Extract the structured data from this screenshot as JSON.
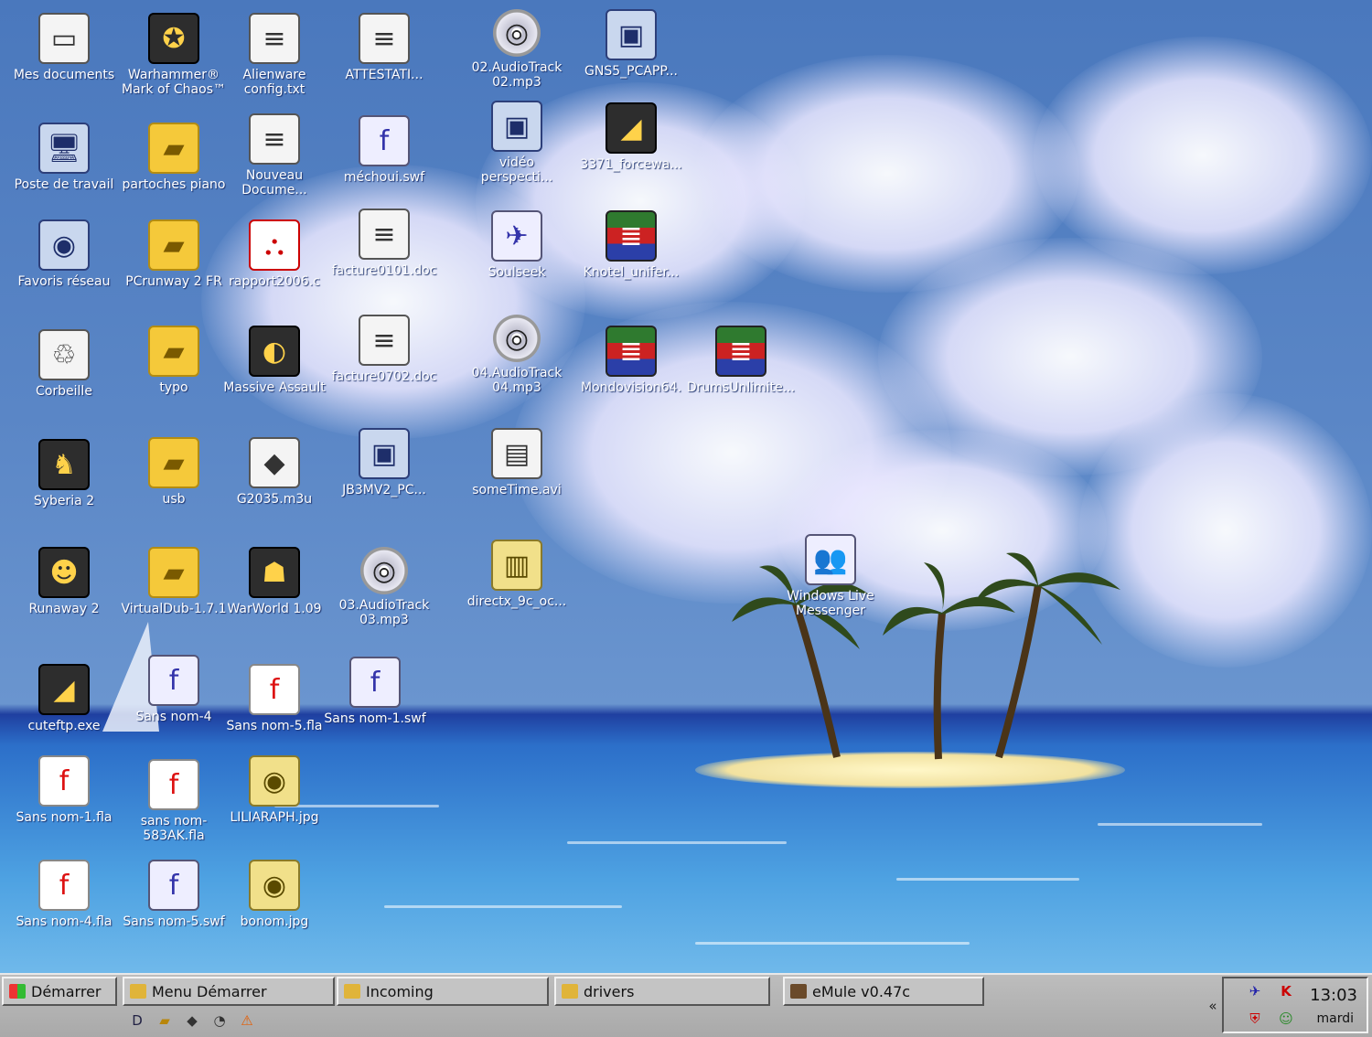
{
  "desktop": {
    "icons": [
      {
        "label": "Mes documents",
        "glyph": "▭",
        "kind": "doc"
      },
      {
        "label": "Warhammer® Mark of Chaos™",
        "glyph": "✪",
        "kind": "app"
      },
      {
        "label": "Alienware config.txt",
        "glyph": "≡",
        "kind": "doc"
      },
      {
        "label": "ATTESTATI...",
        "glyph": "≡",
        "kind": "doc"
      },
      {
        "label": "02.AudioTrack 02.mp3",
        "glyph": "◎",
        "kind": "disc"
      },
      {
        "label": "GNS5_PCAPP...",
        "glyph": "▣",
        "kind": "pc"
      },
      {
        "label": "Poste de travail",
        "glyph": "🖥",
        "kind": "pc"
      },
      {
        "label": "partoches piano",
        "glyph": "▰",
        "kind": "folder"
      },
      {
        "label": "Nouveau Docume...",
        "glyph": "≡",
        "kind": "doc"
      },
      {
        "label": "méchoui.swf",
        "glyph": "f",
        "kind": "swf"
      },
      {
        "label": "vidéo perspecti...",
        "glyph": "▣",
        "kind": "pc"
      },
      {
        "label": "3371_forcewa...",
        "glyph": "◢",
        "kind": "app"
      },
      {
        "label": "Favoris réseau",
        "glyph": "◉",
        "kind": "pc"
      },
      {
        "label": "PCrunway 2 FR",
        "glyph": "▰",
        "kind": "folder"
      },
      {
        "label": "rapport2006.c",
        "glyph": "⛬",
        "kind": "pdf"
      },
      {
        "label": "facture0101.doc",
        "glyph": "≡",
        "kind": "doc"
      },
      {
        "label": "Soulseek",
        "glyph": "✈",
        "kind": "swf"
      },
      {
        "label": "Knotel_unifer...",
        "glyph": "≣",
        "kind": "rar"
      },
      {
        "label": "Corbeille",
        "glyph": "♲",
        "kind": "doc"
      },
      {
        "label": "typo",
        "glyph": "▰",
        "kind": "folder"
      },
      {
        "label": "Massive Assault",
        "glyph": "◐",
        "kind": "app"
      },
      {
        "label": "facture0702.doc",
        "glyph": "≡",
        "kind": "doc"
      },
      {
        "label": "04.AudioTrack 04.mp3",
        "glyph": "◎",
        "kind": "disc"
      },
      {
        "label": "Mondovision64.",
        "glyph": "≣",
        "kind": "rar"
      },
      {
        "label": "DrumsUnlimite...",
        "glyph": "≣",
        "kind": "rar"
      },
      {
        "label": "Syberia 2",
        "glyph": "♞",
        "kind": "app"
      },
      {
        "label": "usb",
        "glyph": "▰",
        "kind": "folder"
      },
      {
        "label": "G2035.m3u",
        "glyph": "◆",
        "kind": "doc"
      },
      {
        "label": "JB3MV2_PC...",
        "glyph": "▣",
        "kind": "pc"
      },
      {
        "label": "someTime.avi",
        "glyph": "▤",
        "kind": "doc"
      },
      {
        "label": "Runaway 2",
        "glyph": "☻",
        "kind": "app"
      },
      {
        "label": "VirtualDub-1.7.1",
        "glyph": "▰",
        "kind": "folder"
      },
      {
        "label": "WarWorld 1.09",
        "glyph": "☗",
        "kind": "app"
      },
      {
        "label": "03.AudioTrack 03.mp3",
        "glyph": "◎",
        "kind": "disc"
      },
      {
        "label": "directx_9c_oc...",
        "glyph": "▥",
        "kind": "img"
      },
      {
        "label": "Windows Live Messenger",
        "glyph": "👥",
        "kind": "swf"
      },
      {
        "label": "cuteftp.exe",
        "glyph": "◢",
        "kind": "app"
      },
      {
        "label": "Sans nom-4",
        "glyph": "f",
        "kind": "swf"
      },
      {
        "label": "Sans nom-5.fla",
        "glyph": "f",
        "kind": "flash"
      },
      {
        "label": "Sans nom-1.swf",
        "glyph": "f",
        "kind": "swf"
      },
      {
        "label": "Sans nom-1.fla",
        "glyph": "f",
        "kind": "flash"
      },
      {
        "label": "sans nom-583AK.fla",
        "glyph": "f",
        "kind": "flash"
      },
      {
        "label": "LILIARAPH.jpg",
        "glyph": "◉",
        "kind": "img"
      },
      {
        "label": "Sans nom-4.fla",
        "glyph": "f",
        "kind": "flash"
      },
      {
        "label": "Sans nom-5.swf",
        "glyph": "f",
        "kind": "swf"
      },
      {
        "label": "bonom.jpg",
        "glyph": "◉",
        "kind": "img"
      }
    ]
  },
  "taskbar": {
    "start_label": "Démarrer",
    "tasks": [
      {
        "label": "Menu Démarrer",
        "icon_color": "#e0b43a"
      },
      {
        "label": "Incoming",
        "icon_color": "#e0b43a"
      },
      {
        "label": "drivers",
        "icon_color": "#e0b43a"
      },
      {
        "label": "eMule v0.47c",
        "icon_color": "#6a4a2a"
      }
    ],
    "quicklaunch": [
      "D",
      "▰",
      "◆",
      "◔",
      "⚠"
    ],
    "tray": {
      "chevron": "«",
      "clock": "13:03",
      "day": "mardi",
      "icons": [
        "✈",
        "K",
        "⛨",
        "☺"
      ]
    }
  },
  "colors": {
    "accent": "#ffffff",
    "taskbar": "#b4b4b4"
  }
}
